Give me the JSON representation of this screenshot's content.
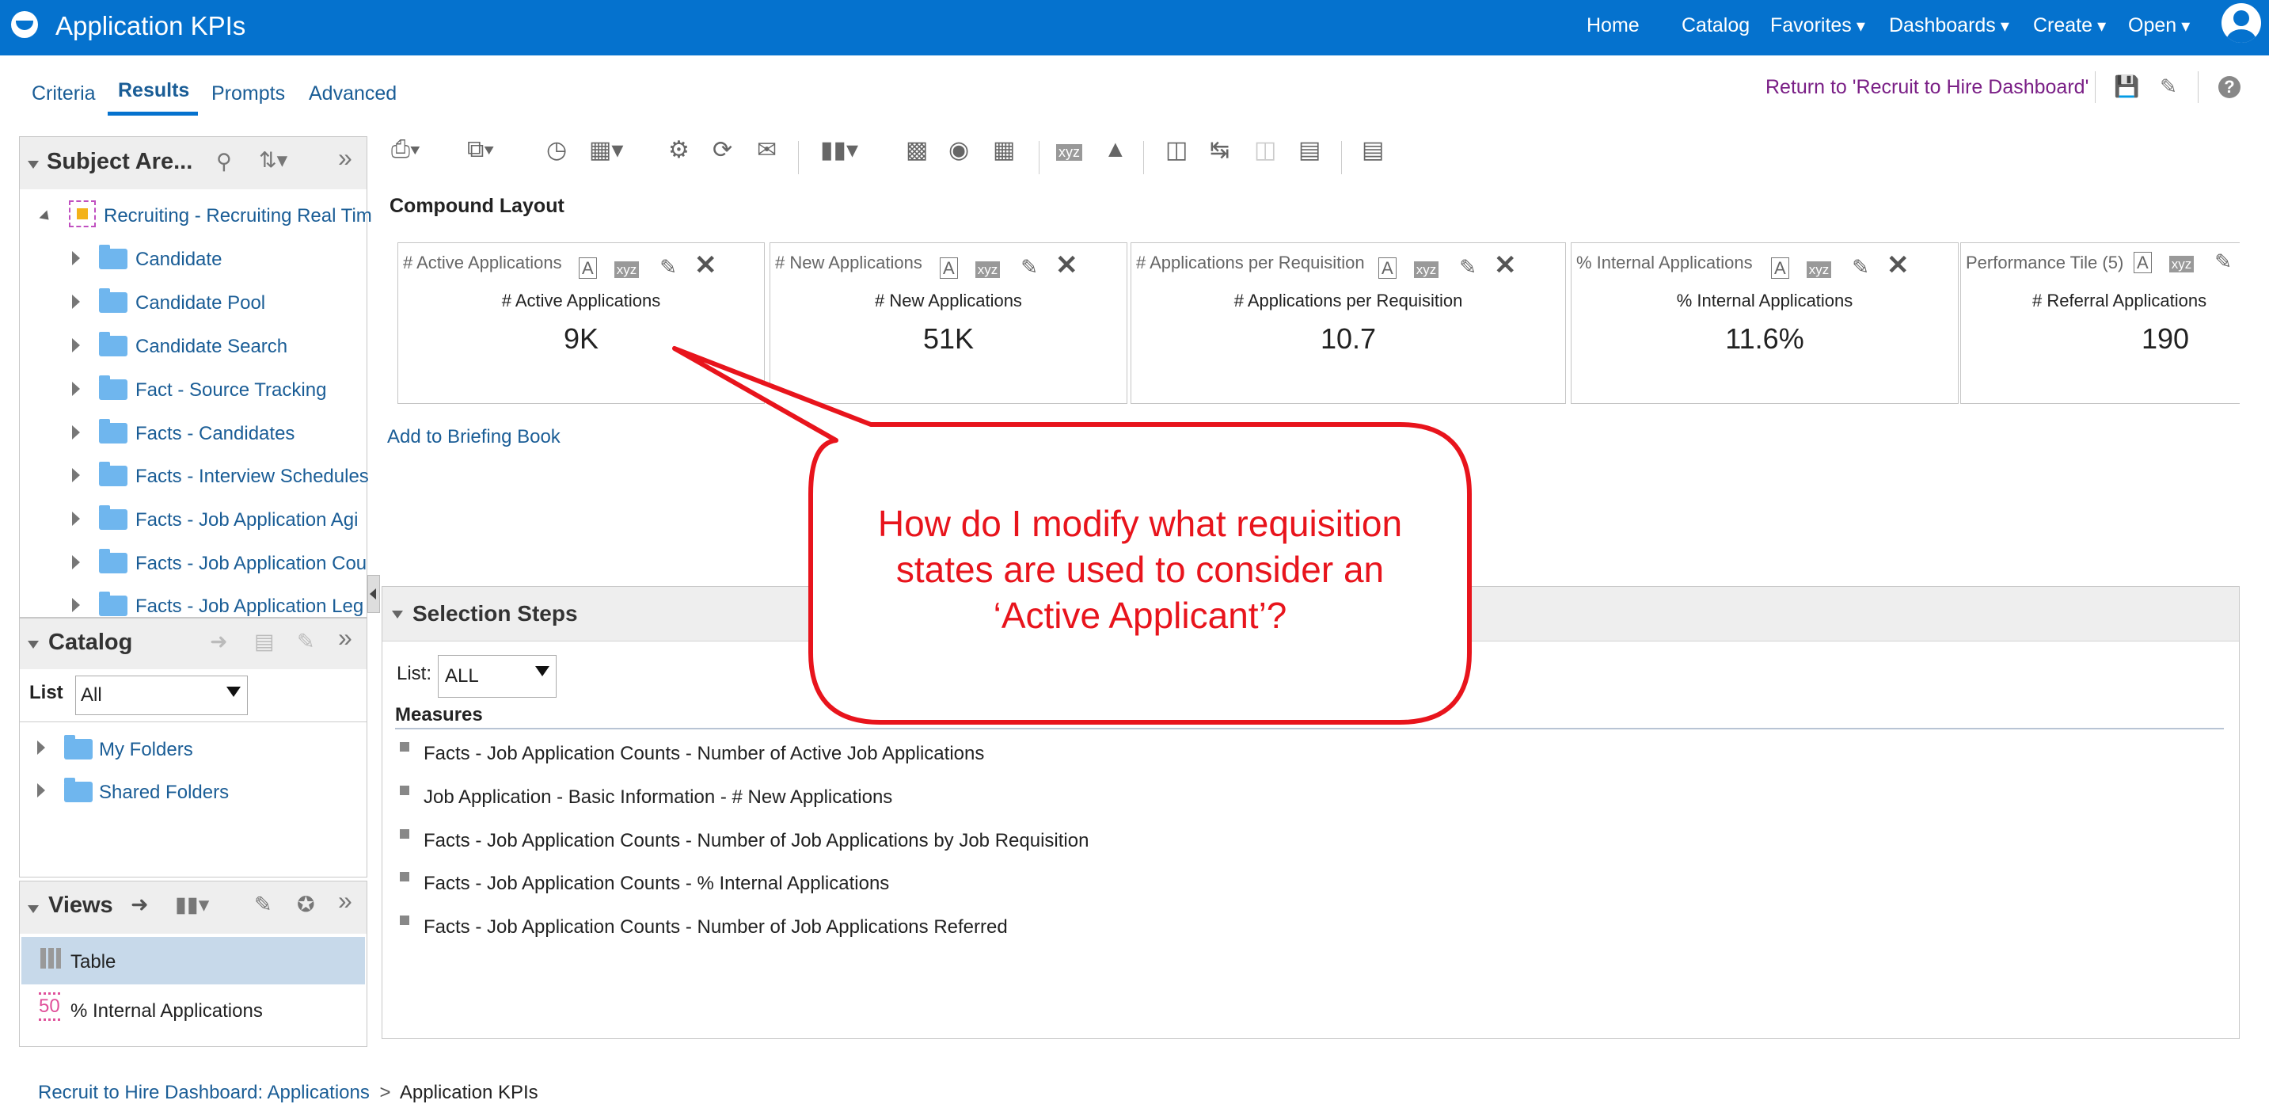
{
  "header": {
    "title": "Application KPIs",
    "nav": [
      "Home",
      "Catalog",
      "Favorites",
      "Dashboards",
      "Create",
      "Open"
    ]
  },
  "tabs": [
    "Criteria",
    "Results",
    "Prompts",
    "Advanced"
  ],
  "return_link": "Return to 'Recruit to Hire Dashboard'",
  "subject_area": {
    "title": "Subject Are...",
    "root": "Recruiting - Recruiting Real Tim",
    "items": [
      "Candidate",
      "Candidate Pool",
      "Candidate Search",
      "Fact - Source Tracking",
      "Facts - Candidates",
      "Facts - Interview Schedules",
      "Facts - Job Application Agi",
      "Facts - Job Application Cou",
      "Facts - Job Application Leg"
    ]
  },
  "catalog": {
    "title": "Catalog",
    "list_label": "List",
    "list_value": "All",
    "items": [
      "My Folders",
      "Shared Folders"
    ]
  },
  "views": {
    "title": "Views",
    "items": [
      {
        "label": "Table",
        "icon": "table-icon",
        "selected": true
      },
      {
        "label": "% Internal Applications",
        "icon": "performance-tile-icon",
        "selected": false
      }
    ],
    "tile_icon_text": "50"
  },
  "compound_layout": {
    "title": "Compound Layout",
    "tiles": [
      {
        "header": "# Active Applications",
        "label": "# Active Applications",
        "value": "9K"
      },
      {
        "header": "# New Applications",
        "label": "# New Applications",
        "value": "51K"
      },
      {
        "header": "# Applications per Requisition",
        "label": "# Applications per Requisition",
        "value": "10.7"
      },
      {
        "header": "% Internal Applications",
        "label": "% Internal Applications",
        "value": "11.6%"
      },
      {
        "header": "Performance Tile (5)",
        "label": "# Referral Applications",
        "value": "190"
      }
    ],
    "add_briefing": "Add to Briefing Book"
  },
  "selection_steps": {
    "title": "Selection Steps",
    "list_label": "List:",
    "list_value": "ALL",
    "measures_title": "Measures",
    "measures": [
      "Facts - Job Application Counts - Number of Active Job Applications",
      "Job Application - Basic Information - # New Applications",
      "Facts - Job Application Counts - Number of Job Applications by Job Requisition",
      "Facts - Job Application Counts - % Internal Applications",
      "Facts - Job Application Counts - Number of Job Applications Referred"
    ]
  },
  "callout": {
    "lines": [
      "How do I modify what requisition",
      "states are used to consider an",
      "‘Active Applicant’?"
    ],
    "color": "#e8141c"
  },
  "footer": {
    "crumb_link": "Recruit to Hire Dashboard: Applications",
    "separator": ">",
    "crumb_current": "Application KPIs"
  },
  "colors": {
    "brand": "#0572ce",
    "link": "#1a5d96",
    "return_link": "#7a1f86"
  }
}
